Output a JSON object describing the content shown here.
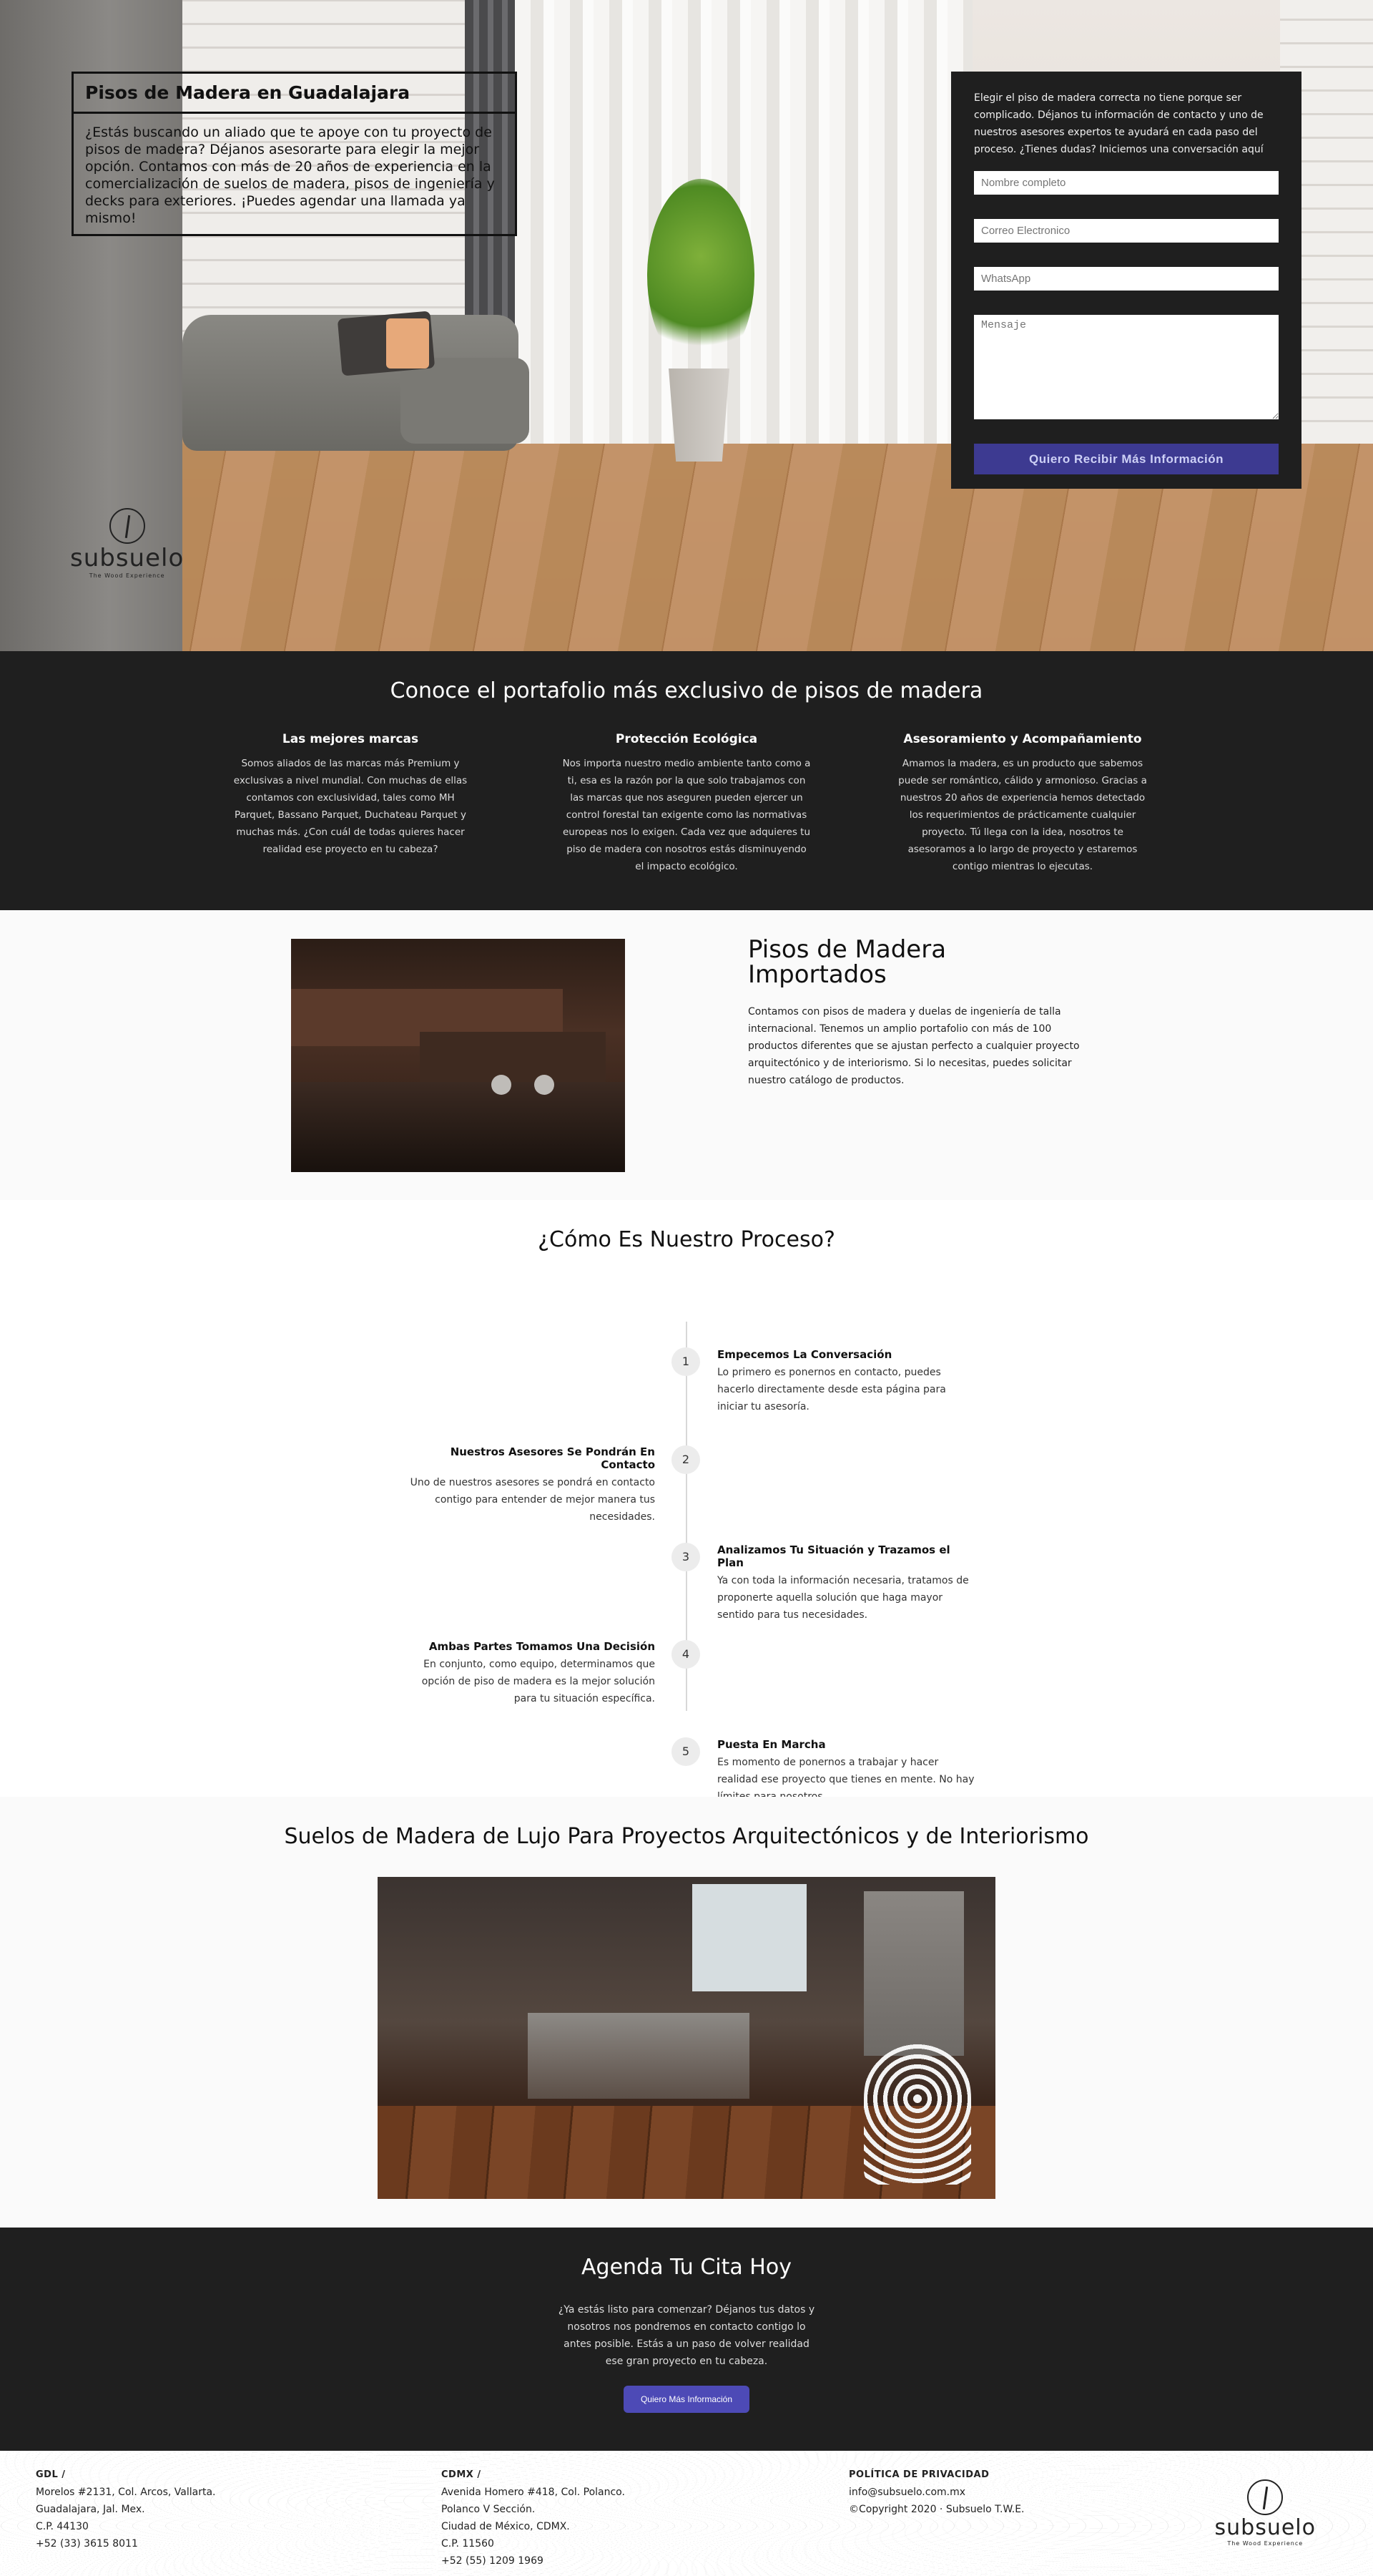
{
  "hero": {
    "title": "Pisos de Madera en Guadalajara",
    "intro": "¿Estás buscando un aliado que te apoye con tu proyecto de pisos de madera? Déjanos asesorarte para elegir la mejor opción. Contamos con más de 20 años de experiencia en la comercialización de suelos de madera, pisos de ingeniería y decks para exteriores. ¡Puedes agendar una llamada ya mismo!",
    "logo_name": "subsuelo",
    "logo_tag": "The Wood Experience"
  },
  "form": {
    "intro": "Elegir el piso de madera correcta no tiene porque ser complicado. Déjanos tu información de contacto y uno de nuestros asesores expertos te ayudará en cada paso del proceso. ¿Tienes dudas? Iniciemos una conversación aquí",
    "name_placeholder": "Nombre completo",
    "email_placeholder": "Correo Electronico",
    "whatsapp_placeholder": "WhatsApp",
    "message_placeholder": "Mensaje",
    "submit_label": "Quiero Recibir Más Información"
  },
  "features": {
    "heading": "Conoce el portafolio más exclusivo de pisos de madera",
    "items": [
      {
        "title": "Las mejores marcas",
        "text": "Somos aliados de las marcas más Premium y exclusivas a nivel mundial. Con muchas de ellas contamos con exclusividad, tales como MH Parquet, Bassano Parquet, Duchateau Parquet y muchas más. ¿Con cuál de todas quieres hacer realidad ese proyecto en tu cabeza?"
      },
      {
        "title": "Protección Ecológica",
        "text": "Nos importa nuestro medio ambiente tanto como a ti, esa es la razón por la que solo trabajamos con las marcas que nos aseguren pueden ejercer un control forestal tan exigente como las normativas europeas nos lo exigen. Cada vez que adquieres tu piso de madera con nosotros estás disminuyendo el impacto ecológico."
      },
      {
        "title": "Asesoramiento y Acompañamiento",
        "text": "Amamos la madera, es un producto que sabemos puede ser romántico, cálido y armonioso. Gracias a nuestros 20 años de experiencia hemos detectado los requerimientos de prácticamente cualquier proyecto. Tú llega con la idea, nosotros te asesoramos a lo largo de proyecto y estaremos contigo mientras lo ejecutas."
      }
    ]
  },
  "imported": {
    "heading": "Pisos de Madera Importados",
    "text": "Contamos con pisos de madera y duelas de ingeniería de talla internacional. Tenemos un amplio portafolio con más de 100 productos diferentes que se ajustan perfecto a cualquier proyecto arquitectónico y de interiorismo. Si lo necesitas, puedes solicitar nuestro catálogo de productos."
  },
  "process": {
    "heading": "¿Cómo Es Nuestro Proceso?",
    "steps": [
      {
        "num": "1",
        "title": "Empecemos La Conversación",
        "text": "Lo primero es ponernos en contacto, puedes hacerlo directamente desde esta página para iniciar tu asesoría."
      },
      {
        "num": "2",
        "title": "Nuestros Asesores Se Pondrán En Contacto",
        "text": "Uno de nuestros asesores se pondrá en contacto contigo para entender de mejor manera tus necesidades."
      },
      {
        "num": "3",
        "title": "Analizamos Tu Situación y Trazamos el Plan",
        "text": "Ya con toda la información necesaria, tratamos de proponerte aquella solución que haga mayor sentido para tus necesidades."
      },
      {
        "num": "4",
        "title": "Ambas Partes Tomamos Una Decisión",
        "text": "En conjunto, como equipo, determinamos que opción de piso de madera es la mejor solución para tu situación específica."
      },
      {
        "num": "5",
        "title": "Puesta En Marcha",
        "text": "Es momento de ponernos a trabajar y hacer realidad ese proyecto que tienes en mente. No hay límites para nosotros."
      }
    ]
  },
  "luxury": {
    "heading": "Suelos de Madera de Lujo Para Proyectos Arquitectónicos y de Interiorismo"
  },
  "cta": {
    "heading": "Agenda Tu Cita Hoy",
    "text": "¿Ya estás listo para comenzar? Déjanos tus datos y nosotros nos pondremos en contacto contigo lo antes posible. Estás a un paso de volver realidad ese gran proyecto en tu cabeza.",
    "button_label": "Quiero Más Información"
  },
  "footer": {
    "gdl": {
      "title": "GDL /",
      "lines": [
        "Morelos #2131, Col. Arcos, Vallarta.",
        "Guadalajara, Jal. Mex.",
        "C.P. 44130",
        "+52 (33) 3615 8011"
      ]
    },
    "cdmx": {
      "title": "CDMX /",
      "lines": [
        "Avenida Homero #418, Col. Polanco.",
        "Polanco V Sección.",
        "Ciudad de México, CDMX.",
        "C.P. 11560",
        "+52 (55) 1209 1969"
      ]
    },
    "privacy": {
      "title": "POLÍTICA DE PRIVACIDAD",
      "lines": [
        "info@subsuelo.com.mx",
        "©Copyright 2020 · Subsuelo T.W.E."
      ]
    },
    "logo_name": "subsuelo",
    "logo_tag": "The Wood Experience"
  }
}
